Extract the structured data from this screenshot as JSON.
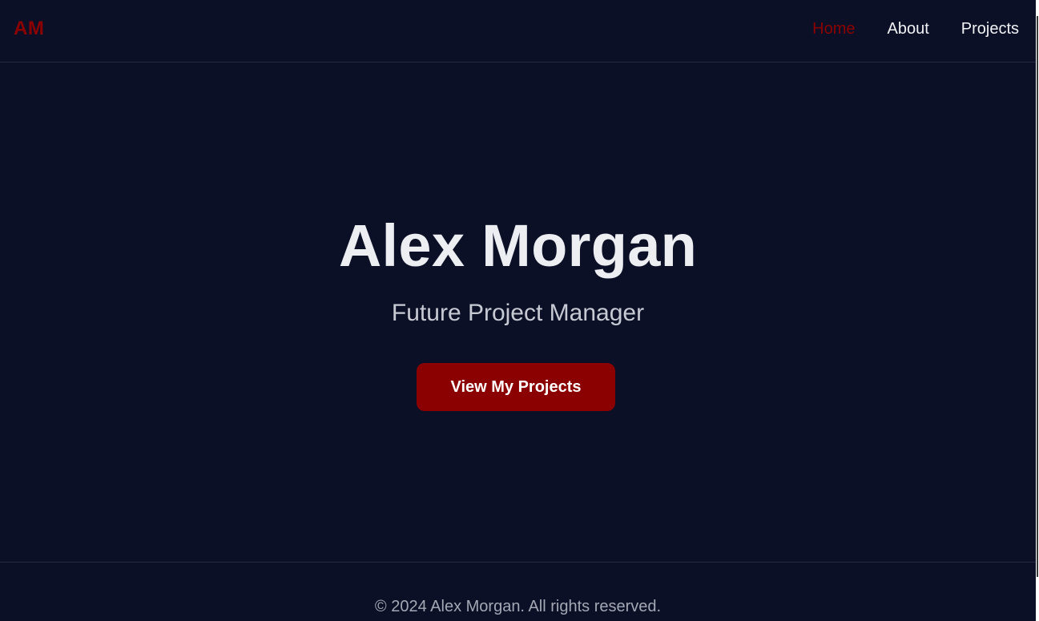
{
  "header": {
    "logo": "AM",
    "nav": [
      {
        "label": "Home",
        "active": true
      },
      {
        "label": "About",
        "active": false
      },
      {
        "label": "Projects",
        "active": false
      }
    ]
  },
  "hero": {
    "title": "Alex Morgan",
    "subtitle": "Future Project Manager",
    "cta_label": "View My Projects"
  },
  "footer": {
    "text": "© 2024 Alex Morgan. All rights reserved."
  },
  "colors": {
    "background": "#0b1027",
    "accent": "#8b0000",
    "text": "#eceef2",
    "muted": "#a4a8b4"
  }
}
